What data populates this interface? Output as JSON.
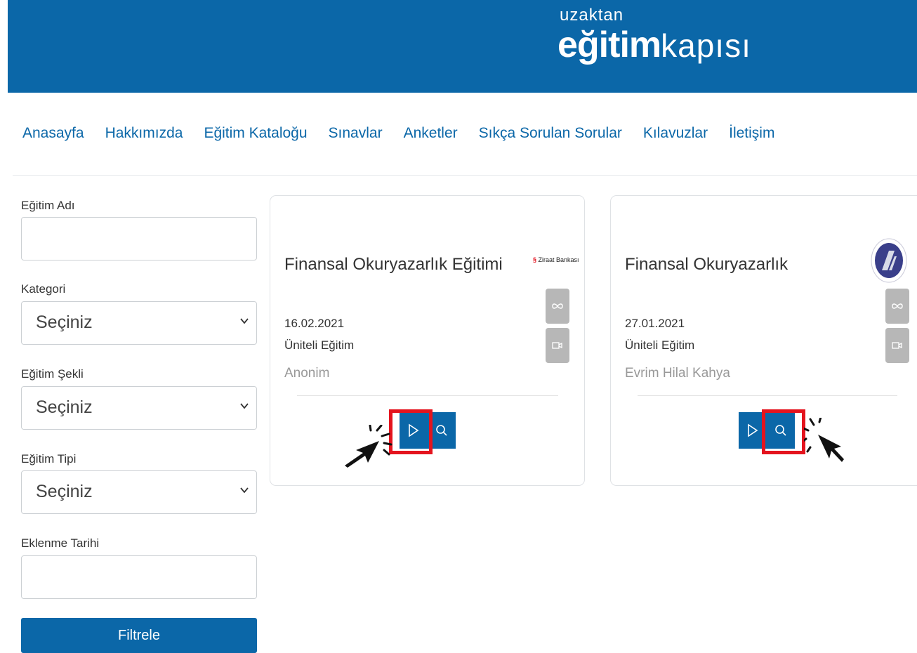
{
  "header": {
    "logo_top": "uzaktan",
    "logo_bold": "eğitim",
    "logo_light": "kapısı"
  },
  "nav": {
    "items": [
      "Anasayfa",
      "Hakkımızda",
      "Eğitim Kataloğu",
      "Sınavlar",
      "Anketler",
      "Sıkça Sorulan Sorular",
      "Kılavuzlar",
      "İletişim"
    ]
  },
  "filters": {
    "name_label": "Eğitim Adı",
    "name_value": "",
    "category_label": "Kategori",
    "category_value": "Seçiniz",
    "shape_label": "Eğitim Şekli",
    "shape_value": "Seçiniz",
    "type_label": "Eğitim Tipi",
    "type_value": "Seçiniz",
    "date_label": "Eklenme Tarihi",
    "date_value": "",
    "submit_label": "Filtrele"
  },
  "cards": [
    {
      "title": "Finansal Okuryazarlık Eğitimi",
      "date": "16.02.2021",
      "type": "Üniteli Eğitim",
      "author": "Anonim",
      "provider_logo_text": "Ziraat Bankası",
      "highlighted_action": "play"
    },
    {
      "title": "Finansal Okuryazarlık",
      "date": "27.01.2021",
      "type": "Üniteli Eğitim",
      "author": "Evrim Hilal Kahya",
      "highlighted_action": "detail"
    }
  ],
  "icons": {
    "infinity": "infinity-icon",
    "video": "video-icon",
    "play": "play-icon",
    "search": "search-icon",
    "chevron": "chevron-down-icon",
    "cursor": "click-cursor-icon"
  },
  "colors": {
    "brand": "#0b67a8",
    "highlight": "#e4141e",
    "muted_button": "#b7b7b7"
  }
}
